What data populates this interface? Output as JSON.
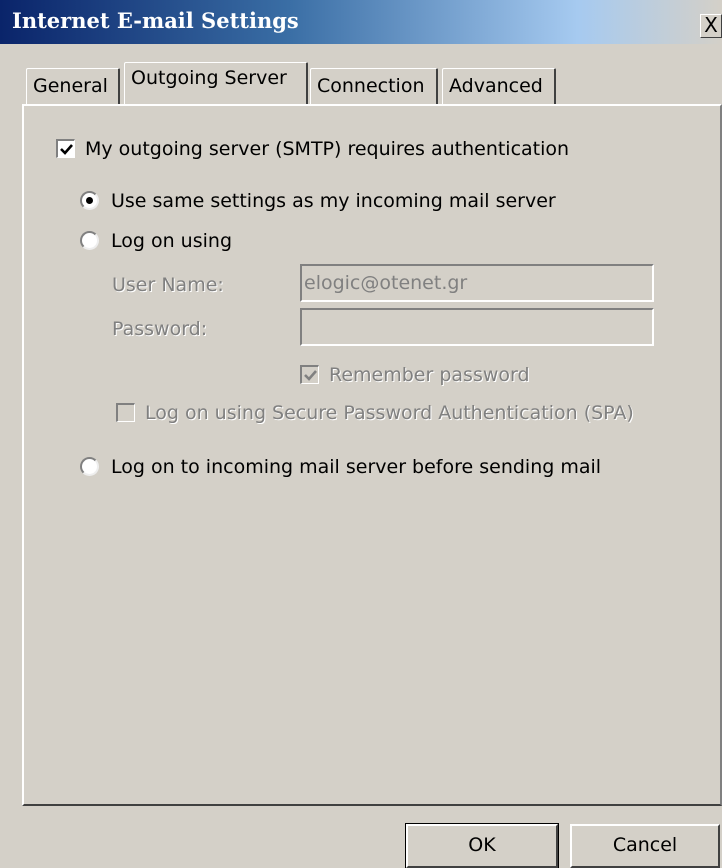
{
  "window": {
    "title": "Internet E-mail Settings",
    "close_glyph": "X"
  },
  "tabs": [
    {
      "label": "General",
      "active": false
    },
    {
      "label": "Outgoing Server",
      "active": true
    },
    {
      "label": "Connection",
      "active": false
    },
    {
      "label": "Advanced",
      "active": false
    }
  ],
  "outgoing": {
    "requires_auth": {
      "label": "My outgoing server (SMTP) requires authentication",
      "checked": true
    },
    "radio_same_settings": {
      "label": "Use same settings as my incoming mail server",
      "selected": true
    },
    "radio_log_on_using": {
      "label": "Log on using",
      "selected": false
    },
    "username": {
      "label": "User Name:",
      "value": "elogic@otenet.gr"
    },
    "password": {
      "label": "Password:",
      "value": ""
    },
    "remember_password": {
      "label": "Remember password",
      "checked": true,
      "enabled": false
    },
    "spa": {
      "label": "Log on using Secure Password Authentication (SPA)",
      "checked": false,
      "enabled": false
    },
    "radio_incoming_first": {
      "label": "Log on to incoming mail server before sending mail",
      "selected": false
    }
  },
  "buttons": {
    "ok": "OK",
    "cancel": "Cancel"
  }
}
